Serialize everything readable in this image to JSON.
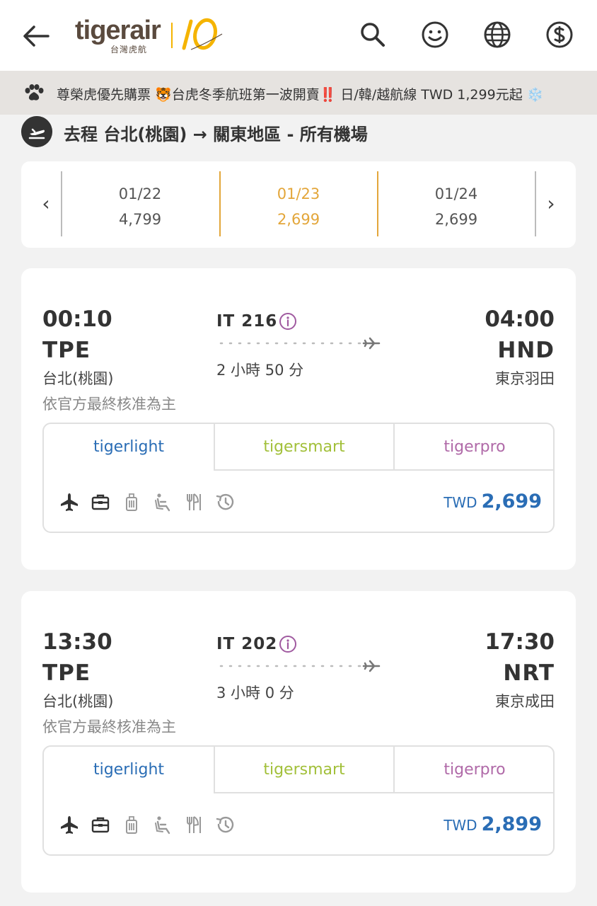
{
  "header": {
    "logo_text": "tigerair",
    "logo_sub": "台灣虎航",
    "icons": [
      "back-arrow-icon",
      "search-icon",
      "smile-icon",
      "globe-icon",
      "currency-icon"
    ]
  },
  "banner": {
    "text": "尊榮虎優先購票 🐯台虎冬季航班第一波開賣‼️ 日/韓/越航線 TWD 1,299元起 ❄️"
  },
  "route": {
    "title": "去程  台北(桃園) → 關東地區 - 所有機場"
  },
  "dates": [
    {
      "date": "01/22",
      "price": "4,799",
      "selected": false
    },
    {
      "date": "01/23",
      "price": "2,699",
      "selected": true
    },
    {
      "date": "01/24",
      "price": "2,699",
      "selected": false
    }
  ],
  "date_nav": {
    "prev": "‹",
    "next": "›"
  },
  "flights": [
    {
      "dep_time": "00:10",
      "dep_code": "TPE",
      "dep_city": "台北(桃園)",
      "note": "依官方最終核准為主",
      "flight_no": "IT 216",
      "duration": "2 小時 50 分",
      "arr_time": "04:00",
      "arr_code": "HND",
      "arr_city": "東京羽田",
      "fare_tabs": [
        "tigerlight",
        "tigersmart",
        "tigerpro"
      ],
      "currency": "TWD",
      "price": "2,699"
    },
    {
      "dep_time": "13:30",
      "dep_code": "TPE",
      "dep_city": "台北(桃園)",
      "note": "依官方最終核准為主",
      "flight_no": "IT 202",
      "duration": "3 小時 0 分",
      "arr_time": "17:30",
      "arr_code": "NRT",
      "arr_city": "東京成田",
      "fare_tabs": [
        "tigerlight",
        "tigersmart",
        "tigerpro"
      ],
      "currency": "TWD",
      "price": "2,899"
    }
  ],
  "colors": {
    "accent_yellow": "#e3a63a",
    "tigerlight_blue": "#2a6db5",
    "tigersmart_green": "#a2c03a",
    "tigerpro_purple": "#b06aa8",
    "banner_bg": "#e6e3e0"
  }
}
